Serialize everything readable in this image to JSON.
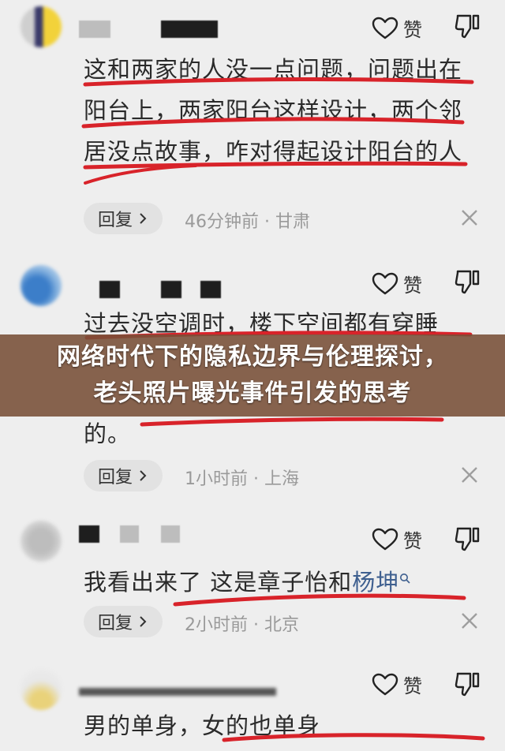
{
  "comments": [
    {
      "text": "这和两家的人没一点问题，问题出在阳台上，两家阳台这样设计，两个邻居没点故事，咋对得起设计阳台的人",
      "like_label": "赞",
      "reply_label": "回复",
      "meta": "46分钟前 · 甘肃"
    },
    {
      "text": "过去没空调时，楼下空间都有穿睡衣出来乘凉的，这就是个生活中很平常的。",
      "text_visible": [
        "过去没空调时，楼下空间都有穿睡",
        "的。"
      ],
      "like_label": "赞",
      "reply_label": "回复",
      "meta": "1小时前 · 上海"
    },
    {
      "text": "我看出来了 这是章子怡和",
      "link": "杨坤",
      "like_label": "赞",
      "reply_label": "回复",
      "meta": "2小时前 · 北京"
    },
    {
      "text": "男的单身，女的也单身",
      "like_label": "赞"
    }
  ],
  "banner": {
    "line1": "网络时代下的隐私边界与伦理探讨，",
    "line2": "老头照片曝光事件引发的思考"
  },
  "colors": {
    "background": "#eeeeee",
    "underline": "#d8232a",
    "banner": "#784e37",
    "meta": "#9a9a9a",
    "link": "#3e5f8f"
  },
  "icons": [
    "thumbs-up-icon",
    "thumbs-down-icon",
    "chevron-right-icon",
    "close-icon",
    "search-icon"
  ]
}
